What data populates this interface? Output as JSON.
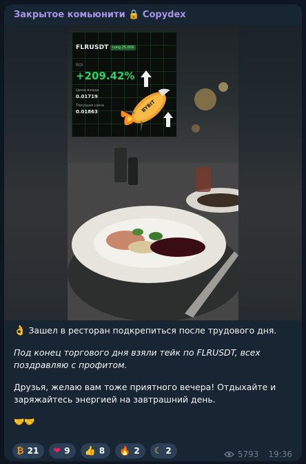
{
  "channel": {
    "name": "Закрытое комьюнити 🔒 Copydex",
    "lock_icon": "lock-icon"
  },
  "trade": {
    "pair": "FLRUSDT",
    "leverage": "Long 25.00X",
    "roi_label": "ROI",
    "roi": "+209.42%",
    "entry_label": "Цена входа",
    "entry": "0.01719",
    "current_label": "Текущая цена",
    "current": "0.01863",
    "brand": "BYBIT"
  },
  "message": {
    "line1_emoji": "👌",
    "line1": "Зашел в ресторан подкрепиться после трудового дня.",
    "line2": "Под конец торгового дня взяли тейк по FLRUSDT, всех поздравляю с профитом.",
    "line3": "Друзья, желаю вам тоже приятного вечера! Отдыхайте и заряжайтесь энергией на завтрашний день.",
    "line4": "🤝🤝"
  },
  "reactions": [
    {
      "icon": "₿",
      "icon_name": "bitcoin-icon",
      "count": "21"
    },
    {
      "icon": "❤",
      "icon_name": "heart-icon",
      "count": "9"
    },
    {
      "icon": "👍",
      "icon_name": "thumbs-up-icon",
      "count": "8"
    },
    {
      "icon": "🔥",
      "icon_name": "fire-icon",
      "count": "2"
    },
    {
      "icon": "☾",
      "icon_name": "moon-icon",
      "count": "2"
    }
  ],
  "meta": {
    "views": "5793",
    "time": "19:36"
  },
  "colors": {
    "bg": "#0e1621",
    "card": "#182533",
    "accent": "#a695e7",
    "roi": "#25d366",
    "reaction": "#2b3f56"
  }
}
